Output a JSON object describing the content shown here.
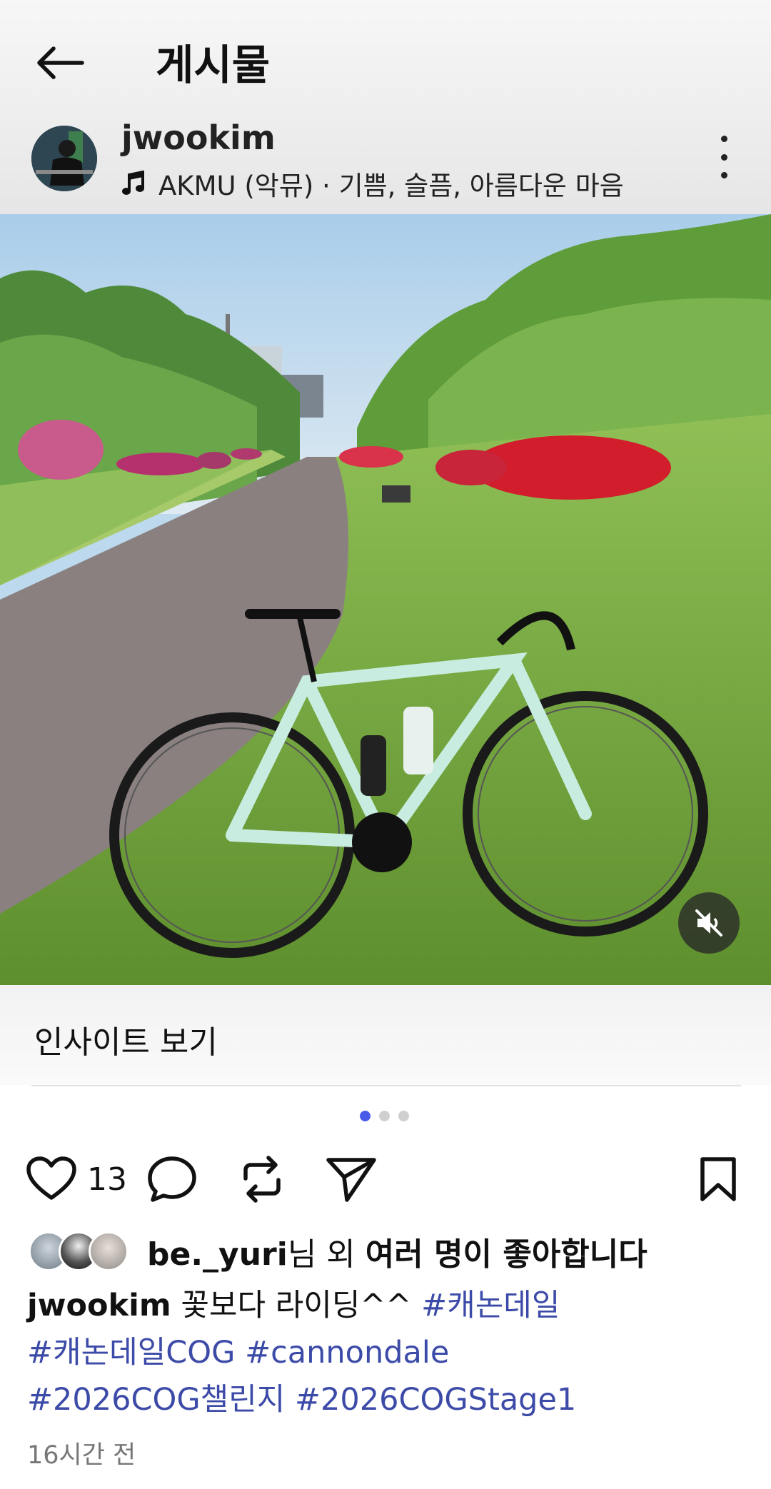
{
  "header": {
    "title": "게시물"
  },
  "post": {
    "username": "jwookim",
    "music": "AKMU (악뮤) · 기쁨, 슬픔, 아름다운 마음"
  },
  "insights": {
    "label": "인사이트 보기"
  },
  "carousel": {
    "count": 3,
    "active_index": 0
  },
  "actions": {
    "like_count": "13"
  },
  "likes": {
    "user": "be._yuri",
    "suffix_1": "님 외 ",
    "suffix_2": "여러 명이 좋아합니다"
  },
  "caption": {
    "author": "jwookim",
    "text": "꽃보다 라이딩^^",
    "hashtags": [
      "#캐논데일",
      "#캐논데일COG",
      "#cannondale",
      "#2026COG챌린지",
      "#2026COGStage1"
    ]
  },
  "timestamp": "16시간 전",
  "colors": {
    "accent": "#4a5bea",
    "hashtag": "#3c4aa8"
  }
}
